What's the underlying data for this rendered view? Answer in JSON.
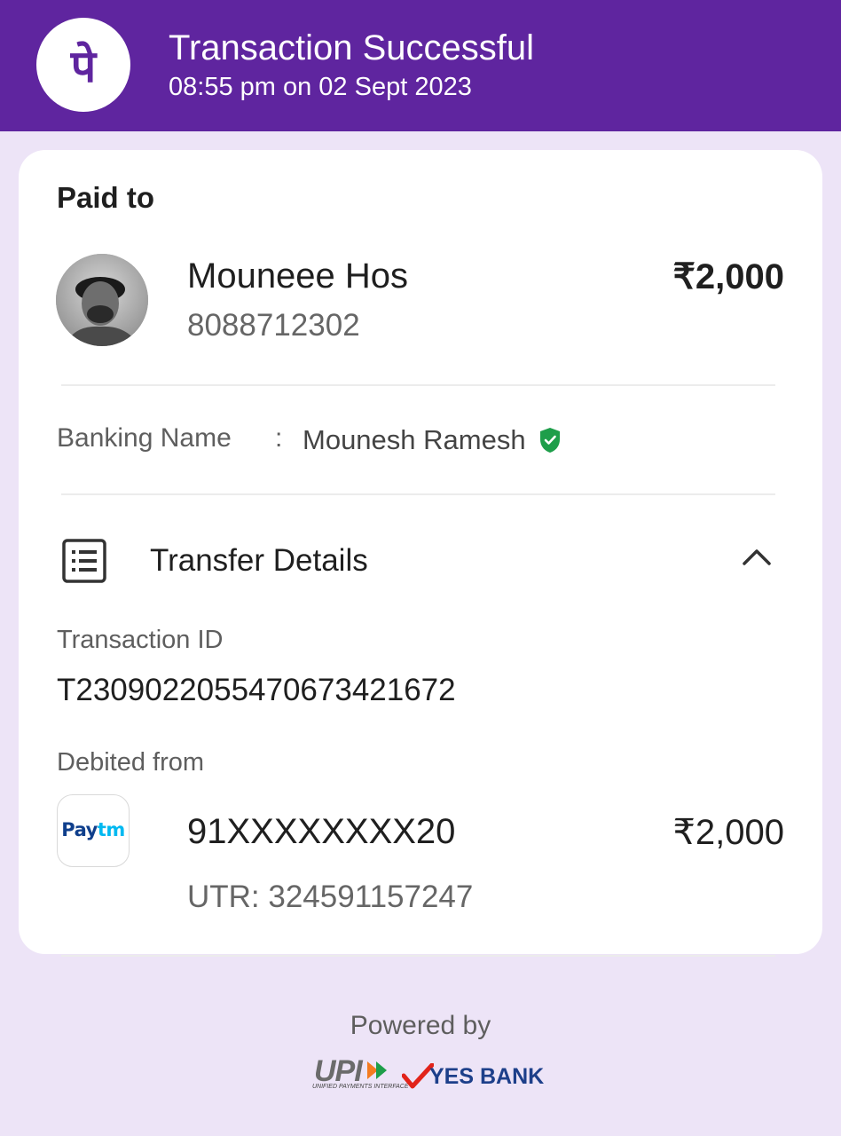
{
  "header": {
    "title": "Transaction Successful",
    "datetime": "08:55 pm on 02 Sept 2023",
    "logo_glyph": "पे",
    "background_color": "#5f259f"
  },
  "payee": {
    "section_label": "Paid to",
    "name": "Mouneee Hos",
    "phone": "8088712302",
    "amount": "₹2,000"
  },
  "banking": {
    "label": "Banking Name",
    "separator": ":",
    "value": "Mounesh Ramesh",
    "verified_icon": "shield-check-icon",
    "verified_color": "#1e9e4a"
  },
  "transfer": {
    "title": "Transfer Details",
    "expanded": true,
    "transaction_id_label": "Transaction ID",
    "transaction_id": "T2309022055470673421672",
    "debited_from_label": "Debited from",
    "source_logo_text_dark": "Pay",
    "source_logo_text_light": "tm",
    "account": "91XXXXXXXX20",
    "amount": "₹2,000",
    "utr": "UTR: 324591157247"
  },
  "footer": {
    "powered_by": "Powered by",
    "upi_text": "UPI",
    "upi_subtext": "UNIFIED PAYMENTS INTERFACE",
    "bank_text": "YES BANK"
  }
}
